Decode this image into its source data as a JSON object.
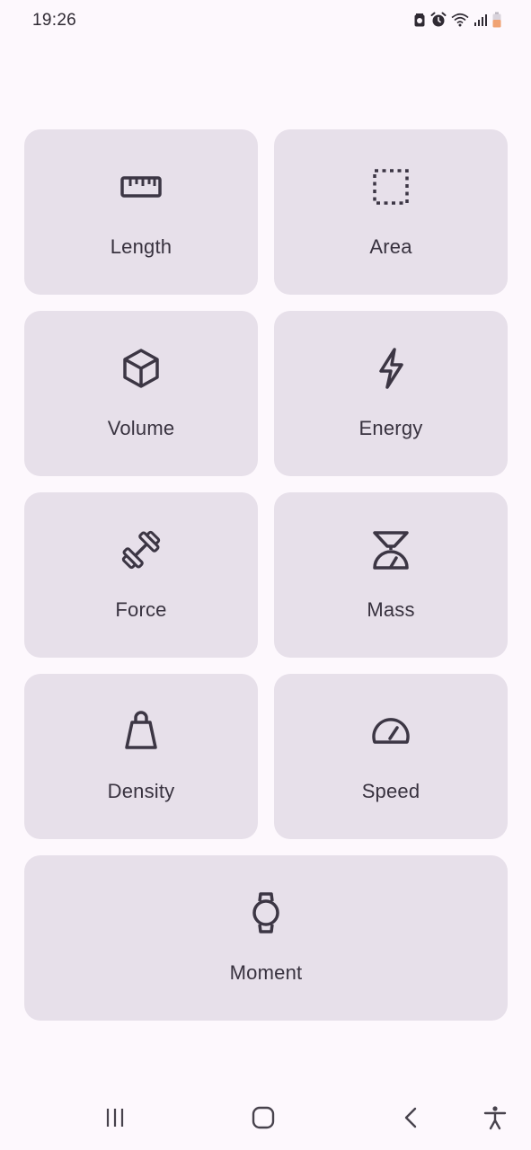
{
  "status_bar": {
    "time": "19:26",
    "icons": [
      "battery-saver-icon",
      "alarm-icon",
      "wifi-icon",
      "signal-icon",
      "battery-low-icon"
    ]
  },
  "categories": [
    {
      "label": "Length",
      "icon": "ruler-icon"
    },
    {
      "label": "Area",
      "icon": "dashed-square-icon"
    },
    {
      "label": "Volume",
      "icon": "cube-icon"
    },
    {
      "label": "Energy",
      "icon": "lightning-icon"
    },
    {
      "label": "Force",
      "icon": "dumbbell-icon"
    },
    {
      "label": "Mass",
      "icon": "scale-icon"
    },
    {
      "label": "Density",
      "icon": "weight-icon"
    },
    {
      "label": "Speed",
      "icon": "speedometer-icon"
    },
    {
      "label": "Moment",
      "icon": "watch-icon"
    }
  ],
  "navigation": {
    "buttons": [
      "recent-apps-icon",
      "home-icon",
      "back-icon",
      "accessibility-icon"
    ]
  },
  "colors": {
    "background": "#fdf8fd",
    "card": "#e7e0ea",
    "icon": "#3c3644",
    "text": "#38323f"
  }
}
